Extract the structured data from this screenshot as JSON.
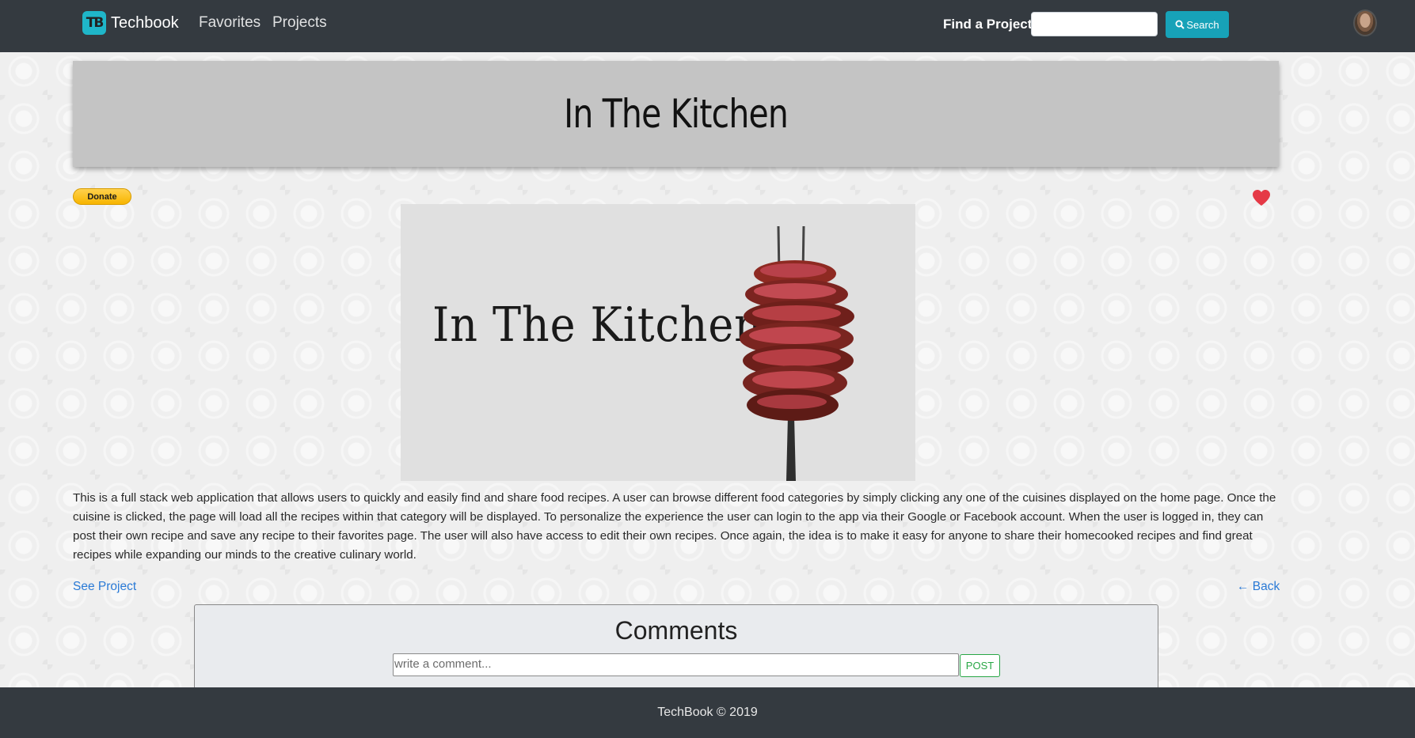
{
  "navbar": {
    "brand_logo": "TB",
    "brand_name": "Techbook",
    "links": [
      "Favorites",
      "Projects"
    ],
    "find_label": "Find a Project",
    "search_value": "",
    "search_button": "Search"
  },
  "project": {
    "title": "In The Kitchen",
    "donate_label": "Donate",
    "image_title": "In The Kitchen",
    "description": "This is a full stack web application that allows users to quickly and easily find and share food recipes. A user can browse different food categories by simply clicking any one of the cuisines displayed on the home page. Once the cuisine is clicked, the page will load all the recipes within that category will be displayed. To personalize the experience the user can login to the app via their Google or Facebook account. When the user is logged in, they can post their own recipe and save any recipe to their favorites page. The user will also have access to edit their own recipes. Once again, the idea is to make it easy for anyone to share their homecooked recipes and find great recipes while expanding our minds to the creative culinary world.",
    "see_project": "See Project",
    "back": "← Back",
    "favorited": true
  },
  "comments": {
    "heading": "Comments",
    "placeholder": "write a comment...",
    "post_label": "POST"
  },
  "footer": {
    "text": "TechBook © 2019"
  },
  "colors": {
    "navbar_bg": "#343a40",
    "accent": "#17a2b8",
    "heart": "#e53946",
    "link": "#2a7ad6"
  }
}
